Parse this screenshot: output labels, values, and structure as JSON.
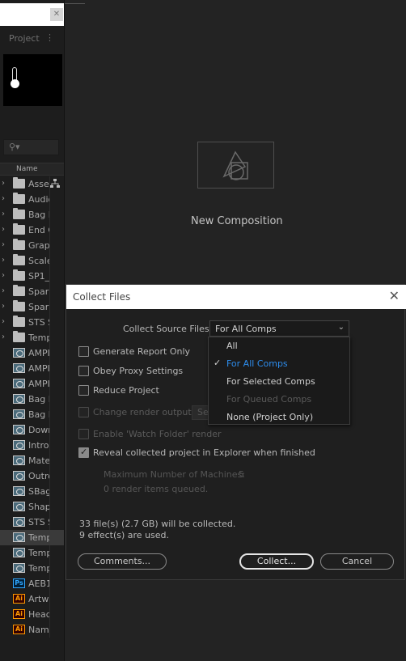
{
  "panel": {
    "title": "Project",
    "menu_icon": "⋮",
    "column_name": "Name",
    "items": [
      {
        "label": "Asset",
        "icon": "folder",
        "expand": true
      },
      {
        "label": "Audio",
        "icon": "folder",
        "expand": true
      },
      {
        "label": "Bag F",
        "icon": "folder",
        "expand": true
      },
      {
        "label": "End C",
        "icon": "folder",
        "expand": true
      },
      {
        "label": "Graph",
        "icon": "folder",
        "expand": true
      },
      {
        "label": "Scale",
        "icon": "folder",
        "expand": true
      },
      {
        "label": "SP1_",
        "icon": "folder",
        "expand": true
      },
      {
        "label": "Spark",
        "icon": "folder",
        "expand": true
      },
      {
        "label": "Spark",
        "icon": "folder",
        "expand": true
      },
      {
        "label": "STS S",
        "icon": "folder",
        "expand": true
      },
      {
        "label": "Temp",
        "icon": "folder",
        "expand": true
      },
      {
        "label": "AMPI",
        "icon": "comp",
        "expand": false
      },
      {
        "label": "AMPI",
        "icon": "comp",
        "expand": false
      },
      {
        "label": "AMPI",
        "icon": "comp",
        "expand": false
      },
      {
        "label": "Bag F",
        "icon": "comp",
        "expand": false
      },
      {
        "label": "Bag F",
        "icon": "comp",
        "expand": false
      },
      {
        "label": "Down",
        "icon": "comp",
        "expand": false
      },
      {
        "label": "Intro",
        "icon": "comp",
        "expand": false
      },
      {
        "label": "Mate",
        "icon": "comp",
        "expand": false
      },
      {
        "label": "Outro",
        "icon": "comp",
        "expand": false
      },
      {
        "label": "SBag",
        "icon": "comp",
        "expand": false
      },
      {
        "label": "Shape",
        "icon": "comp",
        "expand": false
      },
      {
        "label": "STS S",
        "icon": "comp",
        "expand": false
      },
      {
        "label": "Temp",
        "icon": "comp",
        "expand": false,
        "selected": true
      },
      {
        "label": "Temp",
        "icon": "comp",
        "expand": false
      },
      {
        "label": "Temp",
        "icon": "comp",
        "expand": false
      },
      {
        "label": "AEB1",
        "icon": "ps",
        "expand": false
      },
      {
        "label": "Artwo",
        "icon": "ai",
        "expand": false
      },
      {
        "label": "Head",
        "icon": "ai",
        "expand": false
      },
      {
        "label": "Name",
        "icon": "ai",
        "expand": false
      }
    ]
  },
  "main": {
    "new_composition_label": "New Composition"
  },
  "dialog": {
    "title": "Collect Files",
    "close_glyph": "✕",
    "collect_source_label": "Collect Source Files:",
    "collect_source_value": "For All Comps",
    "options": {
      "generate_report": {
        "label": "Generate Report Only",
        "checked": false,
        "enabled": true
      },
      "obey_proxy": {
        "label": "Obey Proxy Settings",
        "checked": false,
        "enabled": true
      },
      "reduce_project": {
        "label": "Reduce Project",
        "checked": false,
        "enabled": true
      },
      "change_render_output": {
        "label": "Change render output to",
        "checked": false,
        "enabled": false
      },
      "render_output_value": "Sel",
      "enable_watch_folder": {
        "label": "Enable 'Watch Folder' render",
        "checked": false,
        "enabled": false
      },
      "reveal_in_explorer": {
        "label": "Reveal collected project in Explorer when finished",
        "checked": true,
        "enabled": true
      }
    },
    "max_machines_label": "Maximum Number of Machines:",
    "max_machines_value": "5",
    "render_queued": "0 render items queued.",
    "summary_files": "33 file(s) (2.7 GB) will be collected.",
    "summary_effects": "9 effect(s) are used.",
    "buttons": {
      "comments": "Comments...",
      "collect": "Collect...",
      "cancel": "Cancel"
    }
  },
  "dropdown": {
    "items": [
      {
        "label": "All",
        "selected": false,
        "enabled": true
      },
      {
        "label": "For All Comps",
        "selected": true,
        "enabled": true
      },
      {
        "label": "For Selected Comps",
        "selected": false,
        "enabled": true
      },
      {
        "label": "For Queued Comps",
        "selected": false,
        "enabled": false
      },
      {
        "label": "None (Project Only)",
        "selected": false,
        "enabled": true
      }
    ]
  },
  "colors": {
    "accent": "#2d8ceb",
    "background": "#232323",
    "dialog_bg": "#1f1f1f"
  }
}
